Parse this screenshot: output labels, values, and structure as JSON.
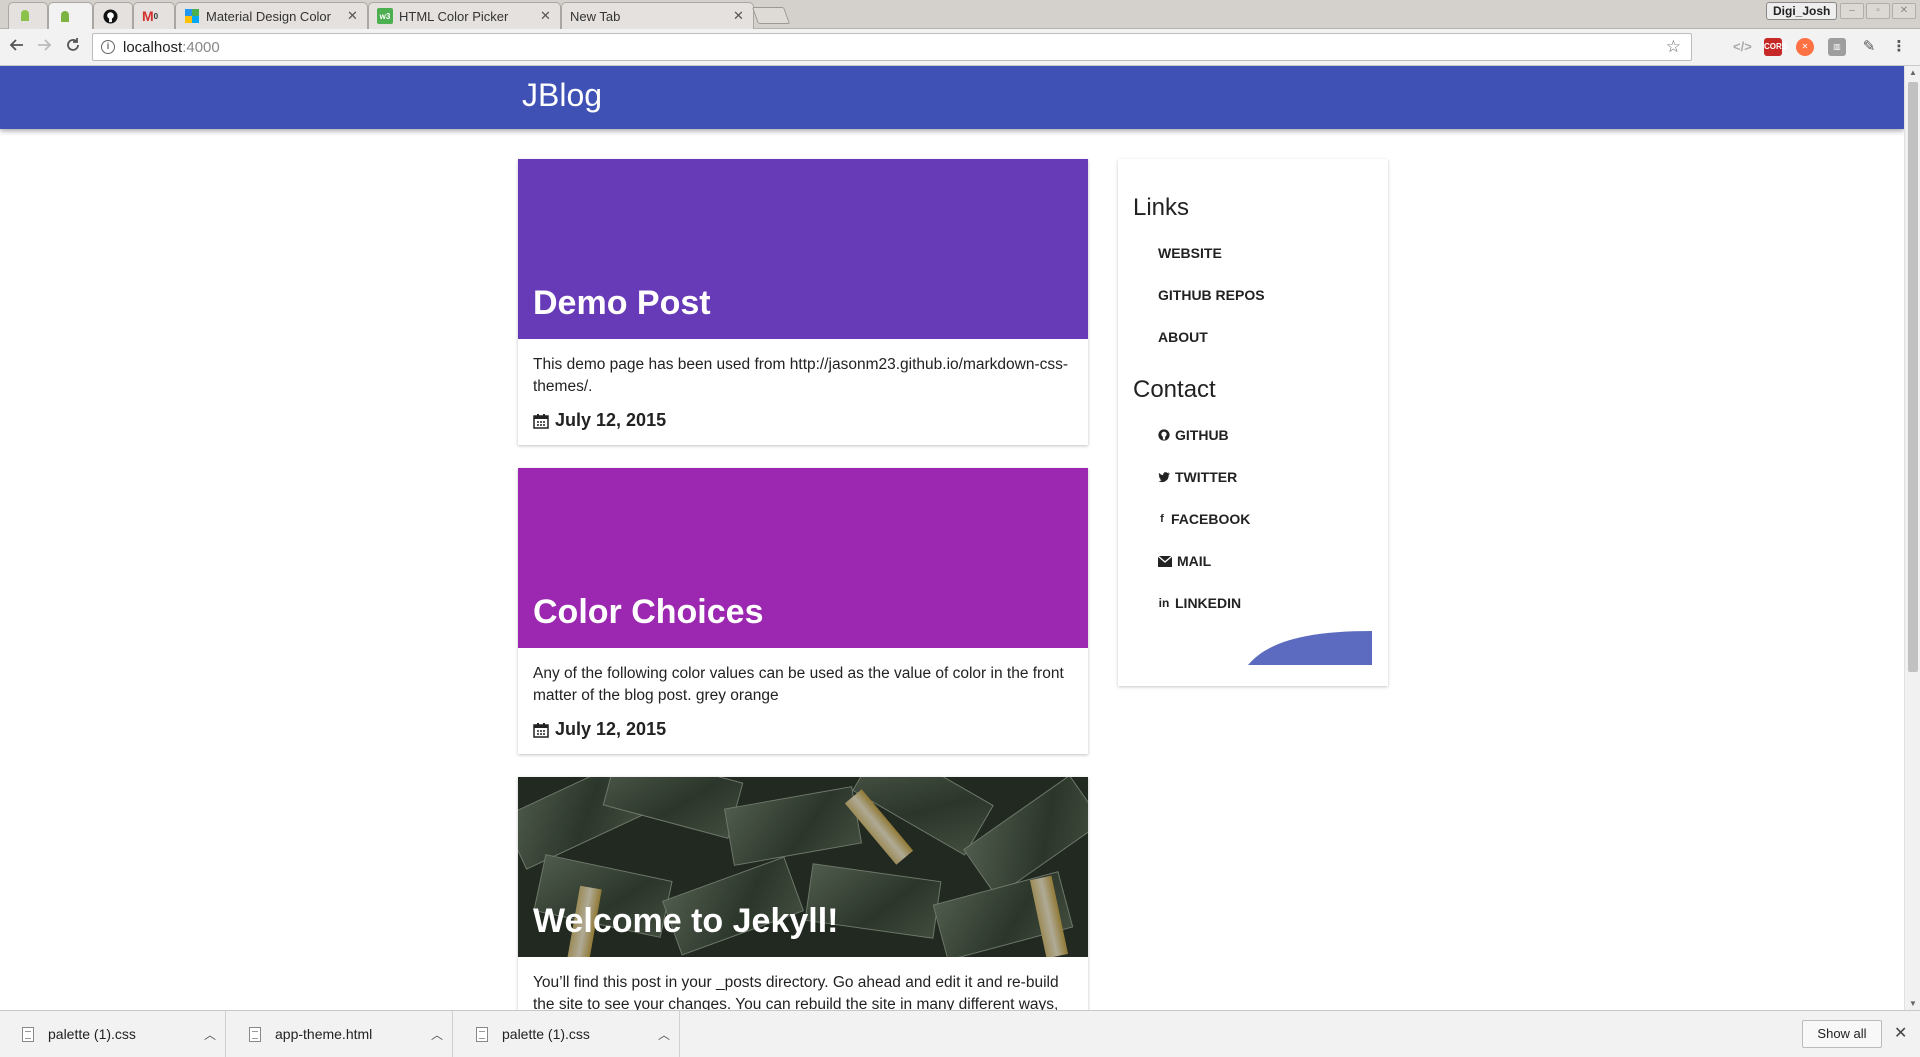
{
  "browser": {
    "tabs": [
      {
        "label": "",
        "icon": "android-icon"
      },
      {
        "label": "",
        "icon": "android-icon",
        "active": true
      },
      {
        "label": "",
        "icon": "github-icon"
      },
      {
        "label": "",
        "icon": "gmail-icon"
      },
      {
        "label": "Material Design Color",
        "icon": "material-icon"
      },
      {
        "label": "HTML Color Picker",
        "icon": "w3schools-icon"
      },
      {
        "label": "New Tab",
        "icon": ""
      }
    ],
    "profile_name": "Digi_Josh",
    "url_host": "localhost",
    "url_port": ":4000",
    "gmail_badge": "0",
    "w3_badge": "w3"
  },
  "page": {
    "site_title": "JBlog",
    "posts": [
      {
        "title": "Demo Post",
        "excerpt": "This demo page has been used from http://jasonm23.github.io/markdown-css-themes/.",
        "date": "July 12, 2015",
        "header_color": "#673ab7"
      },
      {
        "title": "Color Choices",
        "excerpt": "Any of the following color values can be used as the value of color in the front matter of the blog post. grey orange",
        "date": "July 12, 2015",
        "header_color": "#9c27b0"
      },
      {
        "title": "Welcome to Jekyll!",
        "excerpt": "You’ll find this post in your _posts directory. Go ahead and edit it and re-build the site to see your changes. You can rebuild the site in many different ways,",
        "date": "",
        "header_image": "money-bills"
      }
    ],
    "sidebar": {
      "links_heading": "Links",
      "links": [
        "WEBSITE",
        "GITHUB REPOS",
        "ABOUT"
      ],
      "contact_heading": "Contact",
      "contacts": [
        {
          "label": "GITHUB",
          "icon": "github-icon"
        },
        {
          "label": "TWITTER",
          "icon": "twitter-icon"
        },
        {
          "label": "FACEBOOK",
          "icon": "facebook-icon"
        },
        {
          "label": "MAIL",
          "icon": "mail-icon"
        },
        {
          "label": "LINKEDIN",
          "icon": "linkedin-icon"
        }
      ]
    },
    "appbar_color": "#3f51b5"
  },
  "downloads": {
    "items": [
      "palette (1).css",
      "app-theme.html",
      "palette (1).css"
    ],
    "show_all": "Show all"
  }
}
